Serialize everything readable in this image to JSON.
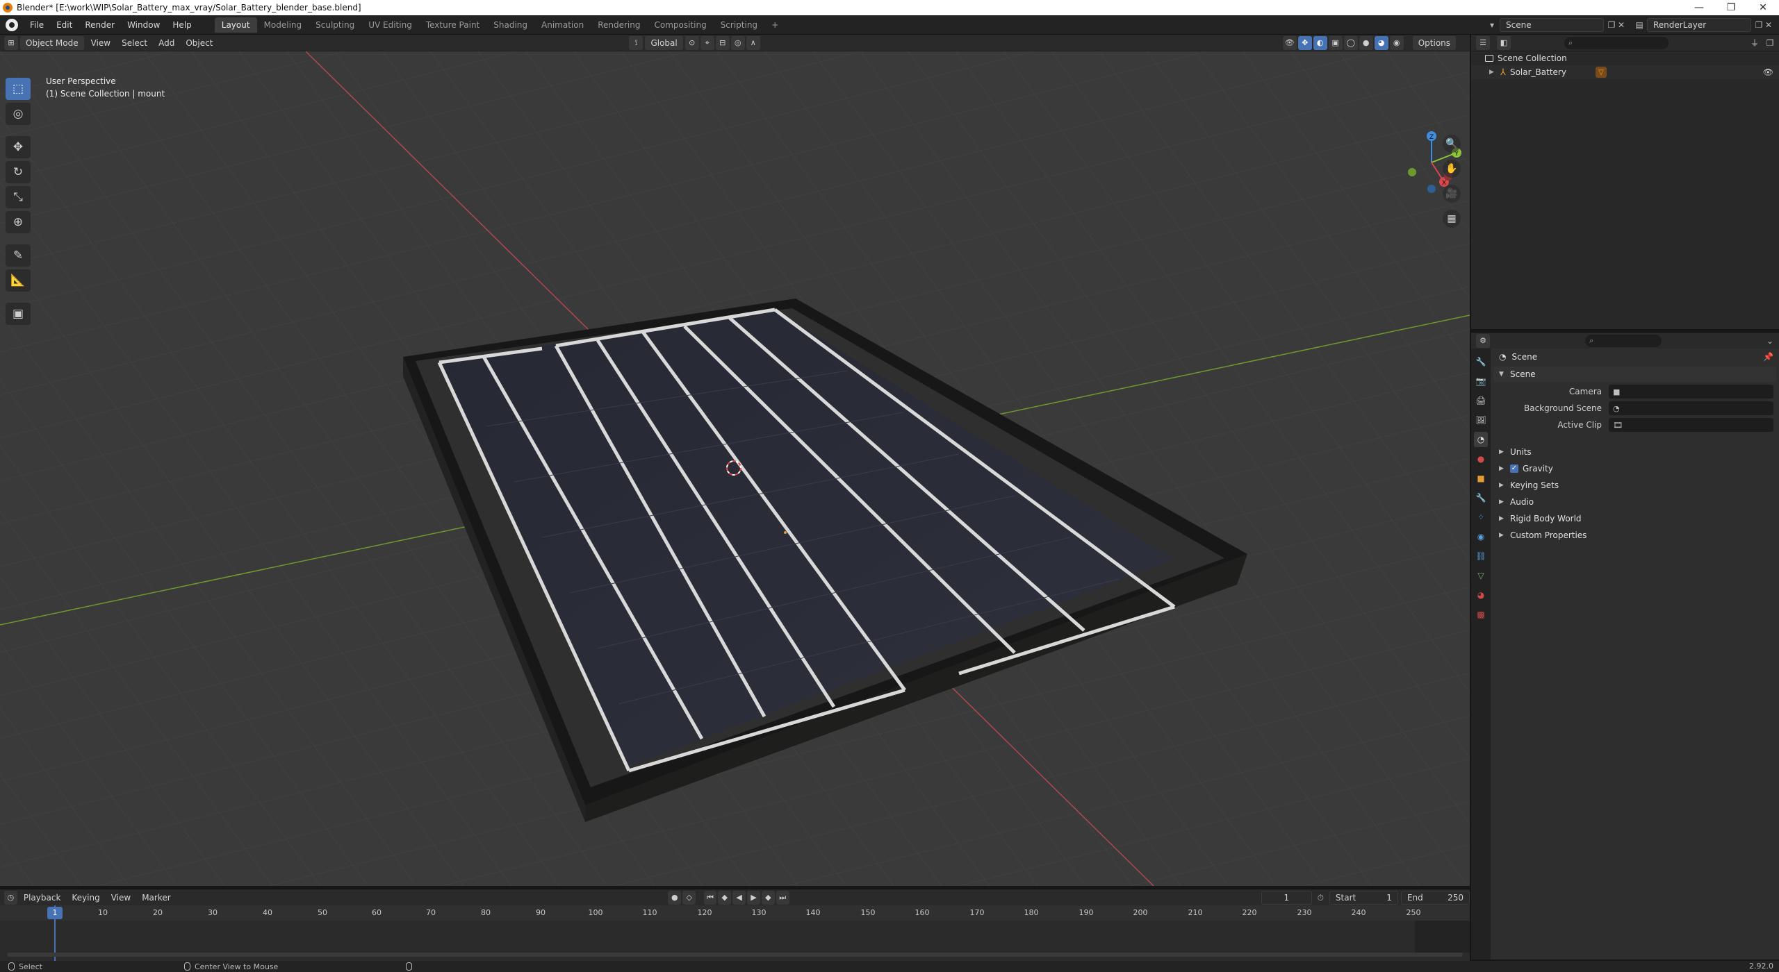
{
  "window": {
    "title": "Blender* [E:\\work\\WIP\\Solar_Battery_max_vray/Solar_Battery_blender_base.blend]",
    "controls": {
      "minimize": "—",
      "maximize": "❐",
      "close": "✕"
    }
  },
  "menu": [
    "File",
    "Edit",
    "Render",
    "Window",
    "Help"
  ],
  "workspaces": [
    {
      "label": "Layout",
      "active": true
    },
    {
      "label": "Modeling",
      "active": false
    },
    {
      "label": "Sculpting",
      "active": false
    },
    {
      "label": "UV Editing",
      "active": false
    },
    {
      "label": "Texture Paint",
      "active": false
    },
    {
      "label": "Shading",
      "active": false
    },
    {
      "label": "Animation",
      "active": false
    },
    {
      "label": "Rendering",
      "active": false
    },
    {
      "label": "Compositing",
      "active": false
    },
    {
      "label": "Scripting",
      "active": false
    }
  ],
  "add_workspace": "+",
  "scene_selector": "Scene",
  "view_layer": "RenderLayer",
  "viewport_header": {
    "mode": "Object Mode",
    "menus": [
      "View",
      "Select",
      "Add",
      "Object"
    ],
    "transform_orientation": "Global",
    "options": "Options"
  },
  "viewport": {
    "perspective": "User Perspective",
    "collection_info": "(1) Scene Collection | mount",
    "gizmo": {
      "x": "X",
      "y": "Y",
      "z": "Z"
    }
  },
  "timeline": {
    "menus": [
      "Playback",
      "Keying",
      "View",
      "Marker"
    ],
    "current_frame": "1",
    "start_label": "Start",
    "start": "1",
    "end_label": "End",
    "end": "250",
    "frames": [
      "10",
      "20",
      "30",
      "40",
      "50",
      "60",
      "70",
      "80",
      "90",
      "100",
      "110",
      "120",
      "130",
      "140",
      "150",
      "160",
      "170",
      "180",
      "190",
      "200",
      "210",
      "220",
      "230",
      "240",
      "250"
    ]
  },
  "outliner": {
    "root": "Scene Collection",
    "items": [
      "Solar_Battery"
    ]
  },
  "properties": {
    "breadcrumb": "Scene",
    "panel_title": "Scene",
    "fields": [
      {
        "label": "Camera",
        "value": ""
      },
      {
        "label": "Background Scene",
        "value": ""
      },
      {
        "label": "Active Clip",
        "value": ""
      }
    ],
    "subpanels": [
      "Units",
      "Gravity",
      "Keying Sets",
      "Audio",
      "Rigid Body World",
      "Custom Properties"
    ]
  },
  "status": {
    "select": "Select",
    "center_view": "Center View to Mouse",
    "version": "2.92.0"
  },
  "colors": {
    "accent": "#4772b3",
    "x_axis": "#d9474d",
    "y_axis": "#8cc43a",
    "z_axis": "#3f8ee0"
  }
}
